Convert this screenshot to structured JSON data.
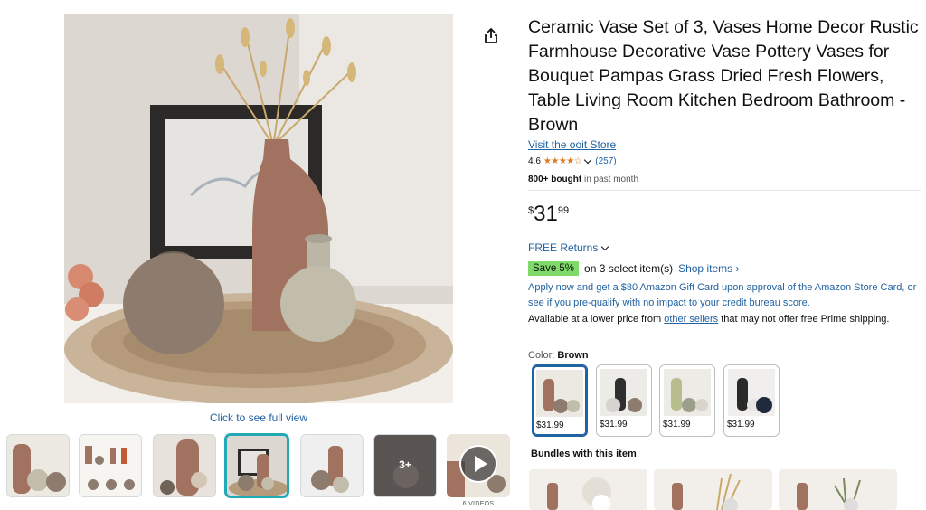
{
  "gallery": {
    "full_view_label": "Click to see full view",
    "more_count": "3+",
    "videos_label": "6 VIDEOS"
  },
  "product": {
    "title": "Ceramic Vase Set of 3, Vases Home Decor Rustic Farmhouse Decorative Vase Pottery Vases for Bouquet Pampas Grass Dried Fresh Flowers, Table Living Room Kitchen Bedroom Bathroom - Brown",
    "store_link": "Visit the ooit Store",
    "rating": "4.6",
    "stars_fraction": 0.92,
    "rating_count": "(257)",
    "bought_bold": "800+ bought",
    "bought_rest": "in past month"
  },
  "price": {
    "symbol": "$",
    "whole": "31",
    "fraction": "99"
  },
  "returns": {
    "label": "FREE Returns"
  },
  "savings": {
    "badge": "Save 5%",
    "text": "on 3 select item(s)",
    "link": "Shop items ›"
  },
  "offer": {
    "apply_text": "Apply now and get a $80 Amazon Gift Card upon approval of the Amazon Store Card, or see if you pre-qualify with no impact to your credit bureau score.",
    "lower_before": "Available at a lower price from",
    "lower_link": "other sellers",
    "lower_after": "that may not offer free Prime shipping."
  },
  "color": {
    "label": "Color:",
    "selected": "Brown",
    "options": [
      {
        "price": "$31.99"
      },
      {
        "price": "$31.99"
      },
      {
        "price": "$31.99"
      },
      {
        "price": "$31.99"
      }
    ]
  },
  "bundles": {
    "title": "Bundles with this item"
  },
  "colors": {
    "link": "#2162a1",
    "star": "#de7921",
    "save_badge": "#7fda69",
    "selected_thumb": "#21a9b5"
  }
}
